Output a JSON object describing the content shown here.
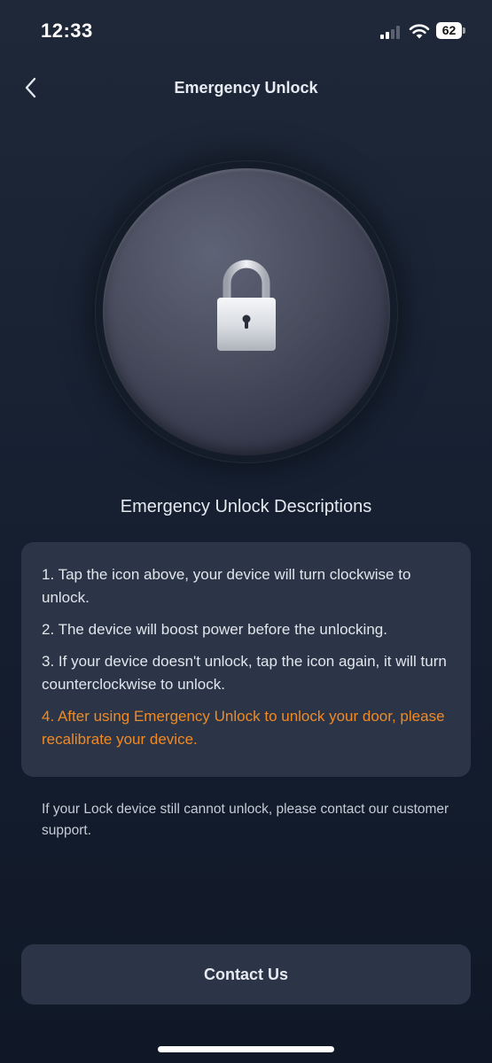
{
  "status_bar": {
    "time": "12:33",
    "battery_level": "62",
    "signal_bars_active": 2,
    "signal_bars_total": 4
  },
  "header": {
    "title": "Emergency Unlock",
    "back_icon": "chevron-left-icon"
  },
  "unlock": {
    "icon": "padlock-icon"
  },
  "descriptions": {
    "title": "Emergency Unlock Descriptions",
    "items": [
      "1. Tap the icon above, your device will turn clockwise to unlock.",
      "2. The device will boost power before the unlocking.",
      "3. If your device doesn't unlock, tap the icon again, it will turn counterclockwise to unlock.",
      "4. After using Emergency Unlock to unlock your door, please recalibrate your device."
    ]
  },
  "note": "If your Lock device still cannot unlock, please contact our customer support.",
  "contact_button": {
    "label": "Contact Us"
  },
  "colors": {
    "background": "#162031",
    "card": "#2b3547",
    "warning_text": "#f08a24",
    "text": "#e6eaf0"
  }
}
